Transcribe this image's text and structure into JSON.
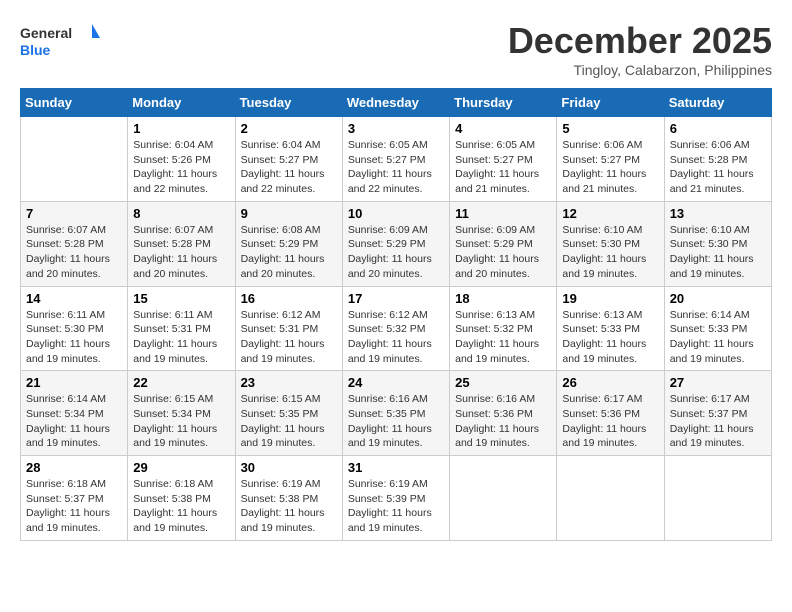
{
  "header": {
    "logo_line1": "General",
    "logo_line2": "Blue",
    "month": "December 2025",
    "location": "Tingloy, Calabarzon, Philippines"
  },
  "weekdays": [
    "Sunday",
    "Monday",
    "Tuesday",
    "Wednesday",
    "Thursday",
    "Friday",
    "Saturday"
  ],
  "weeks": [
    [
      {
        "day": "",
        "info": ""
      },
      {
        "day": "1",
        "info": "Sunrise: 6:04 AM\nSunset: 5:26 PM\nDaylight: 11 hours\nand 22 minutes."
      },
      {
        "day": "2",
        "info": "Sunrise: 6:04 AM\nSunset: 5:27 PM\nDaylight: 11 hours\nand 22 minutes."
      },
      {
        "day": "3",
        "info": "Sunrise: 6:05 AM\nSunset: 5:27 PM\nDaylight: 11 hours\nand 22 minutes."
      },
      {
        "day": "4",
        "info": "Sunrise: 6:05 AM\nSunset: 5:27 PM\nDaylight: 11 hours\nand 21 minutes."
      },
      {
        "day": "5",
        "info": "Sunrise: 6:06 AM\nSunset: 5:27 PM\nDaylight: 11 hours\nand 21 minutes."
      },
      {
        "day": "6",
        "info": "Sunrise: 6:06 AM\nSunset: 5:28 PM\nDaylight: 11 hours\nand 21 minutes."
      }
    ],
    [
      {
        "day": "7",
        "info": "Sunrise: 6:07 AM\nSunset: 5:28 PM\nDaylight: 11 hours\nand 20 minutes."
      },
      {
        "day": "8",
        "info": "Sunrise: 6:07 AM\nSunset: 5:28 PM\nDaylight: 11 hours\nand 20 minutes."
      },
      {
        "day": "9",
        "info": "Sunrise: 6:08 AM\nSunset: 5:29 PM\nDaylight: 11 hours\nand 20 minutes."
      },
      {
        "day": "10",
        "info": "Sunrise: 6:09 AM\nSunset: 5:29 PM\nDaylight: 11 hours\nand 20 minutes."
      },
      {
        "day": "11",
        "info": "Sunrise: 6:09 AM\nSunset: 5:29 PM\nDaylight: 11 hours\nand 20 minutes."
      },
      {
        "day": "12",
        "info": "Sunrise: 6:10 AM\nSunset: 5:30 PM\nDaylight: 11 hours\nand 19 minutes."
      },
      {
        "day": "13",
        "info": "Sunrise: 6:10 AM\nSunset: 5:30 PM\nDaylight: 11 hours\nand 19 minutes."
      }
    ],
    [
      {
        "day": "14",
        "info": "Sunrise: 6:11 AM\nSunset: 5:30 PM\nDaylight: 11 hours\nand 19 minutes."
      },
      {
        "day": "15",
        "info": "Sunrise: 6:11 AM\nSunset: 5:31 PM\nDaylight: 11 hours\nand 19 minutes."
      },
      {
        "day": "16",
        "info": "Sunrise: 6:12 AM\nSunset: 5:31 PM\nDaylight: 11 hours\nand 19 minutes."
      },
      {
        "day": "17",
        "info": "Sunrise: 6:12 AM\nSunset: 5:32 PM\nDaylight: 11 hours\nand 19 minutes."
      },
      {
        "day": "18",
        "info": "Sunrise: 6:13 AM\nSunset: 5:32 PM\nDaylight: 11 hours\nand 19 minutes."
      },
      {
        "day": "19",
        "info": "Sunrise: 6:13 AM\nSunset: 5:33 PM\nDaylight: 11 hours\nand 19 minutes."
      },
      {
        "day": "20",
        "info": "Sunrise: 6:14 AM\nSunset: 5:33 PM\nDaylight: 11 hours\nand 19 minutes."
      }
    ],
    [
      {
        "day": "21",
        "info": "Sunrise: 6:14 AM\nSunset: 5:34 PM\nDaylight: 11 hours\nand 19 minutes."
      },
      {
        "day": "22",
        "info": "Sunrise: 6:15 AM\nSunset: 5:34 PM\nDaylight: 11 hours\nand 19 minutes."
      },
      {
        "day": "23",
        "info": "Sunrise: 6:15 AM\nSunset: 5:35 PM\nDaylight: 11 hours\nand 19 minutes."
      },
      {
        "day": "24",
        "info": "Sunrise: 6:16 AM\nSunset: 5:35 PM\nDaylight: 11 hours\nand 19 minutes."
      },
      {
        "day": "25",
        "info": "Sunrise: 6:16 AM\nSunset: 5:36 PM\nDaylight: 11 hours\nand 19 minutes."
      },
      {
        "day": "26",
        "info": "Sunrise: 6:17 AM\nSunset: 5:36 PM\nDaylight: 11 hours\nand 19 minutes."
      },
      {
        "day": "27",
        "info": "Sunrise: 6:17 AM\nSunset: 5:37 PM\nDaylight: 11 hours\nand 19 minutes."
      }
    ],
    [
      {
        "day": "28",
        "info": "Sunrise: 6:18 AM\nSunset: 5:37 PM\nDaylight: 11 hours\nand 19 minutes."
      },
      {
        "day": "29",
        "info": "Sunrise: 6:18 AM\nSunset: 5:38 PM\nDaylight: 11 hours\nand 19 minutes."
      },
      {
        "day": "30",
        "info": "Sunrise: 6:19 AM\nSunset: 5:38 PM\nDaylight: 11 hours\nand 19 minutes."
      },
      {
        "day": "31",
        "info": "Sunrise: 6:19 AM\nSunset: 5:39 PM\nDaylight: 11 hours\nand 19 minutes."
      },
      {
        "day": "",
        "info": ""
      },
      {
        "day": "",
        "info": ""
      },
      {
        "day": "",
        "info": ""
      }
    ]
  ]
}
